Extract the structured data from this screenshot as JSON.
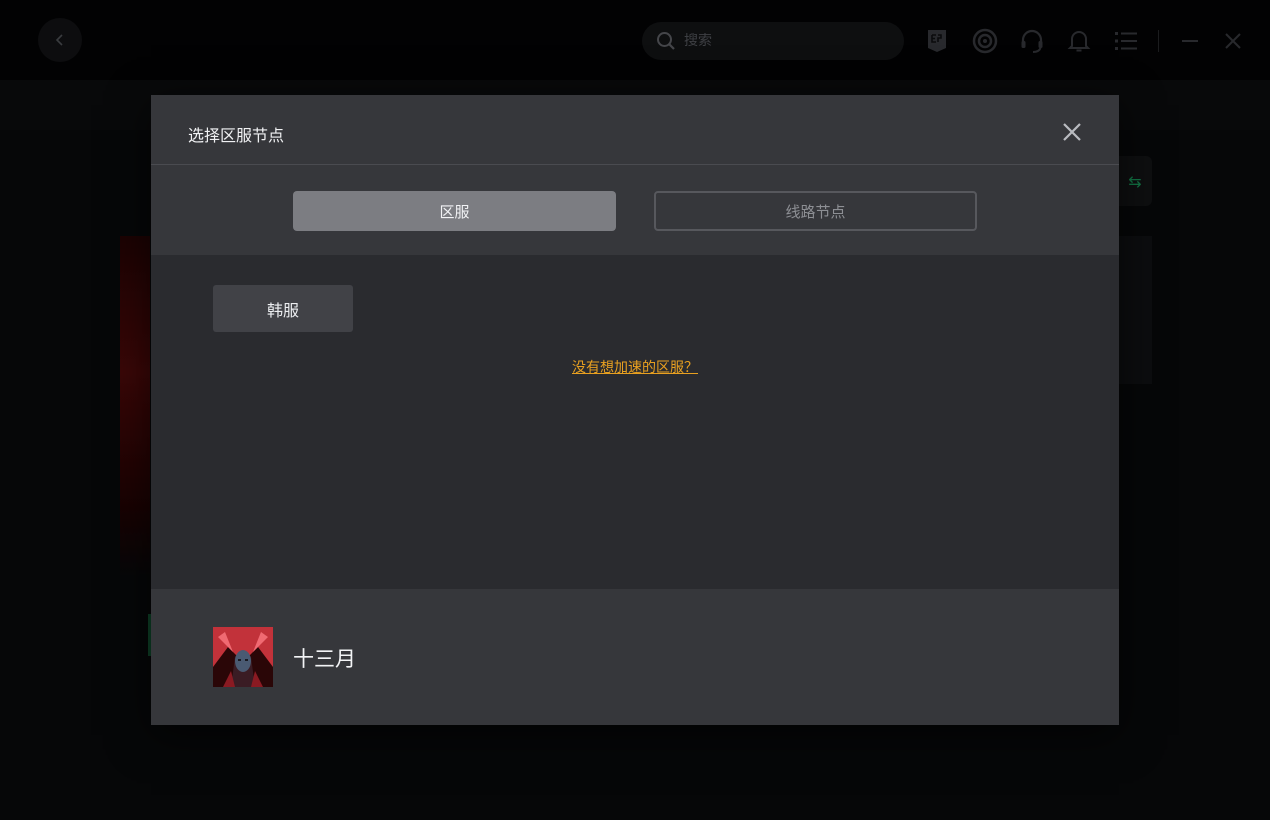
{
  "topbar": {
    "search_placeholder": "搜索",
    "icons": [
      "back-icon",
      "search-icon",
      "epic-games-icon",
      "ubisoft-icon",
      "headset-icon",
      "bell-icon",
      "menu-icon",
      "minimize-icon",
      "close-icon"
    ]
  },
  "modal": {
    "title": "选择区服节点",
    "tabs": [
      {
        "label": "区服",
        "active": true
      },
      {
        "label": "线路节点",
        "active": false
      }
    ],
    "servers": [
      {
        "label": "韩服"
      }
    ],
    "hint_link": "没有想加速的区服？",
    "footer": {
      "game_name": "十三月"
    }
  },
  "colors": {
    "accent_link": "#e8a020",
    "modal_bg": "#2a2b2f",
    "header_bg": "#36373b",
    "active_tab": "#7c7d82",
    "brand_green": "#1db36a"
  }
}
